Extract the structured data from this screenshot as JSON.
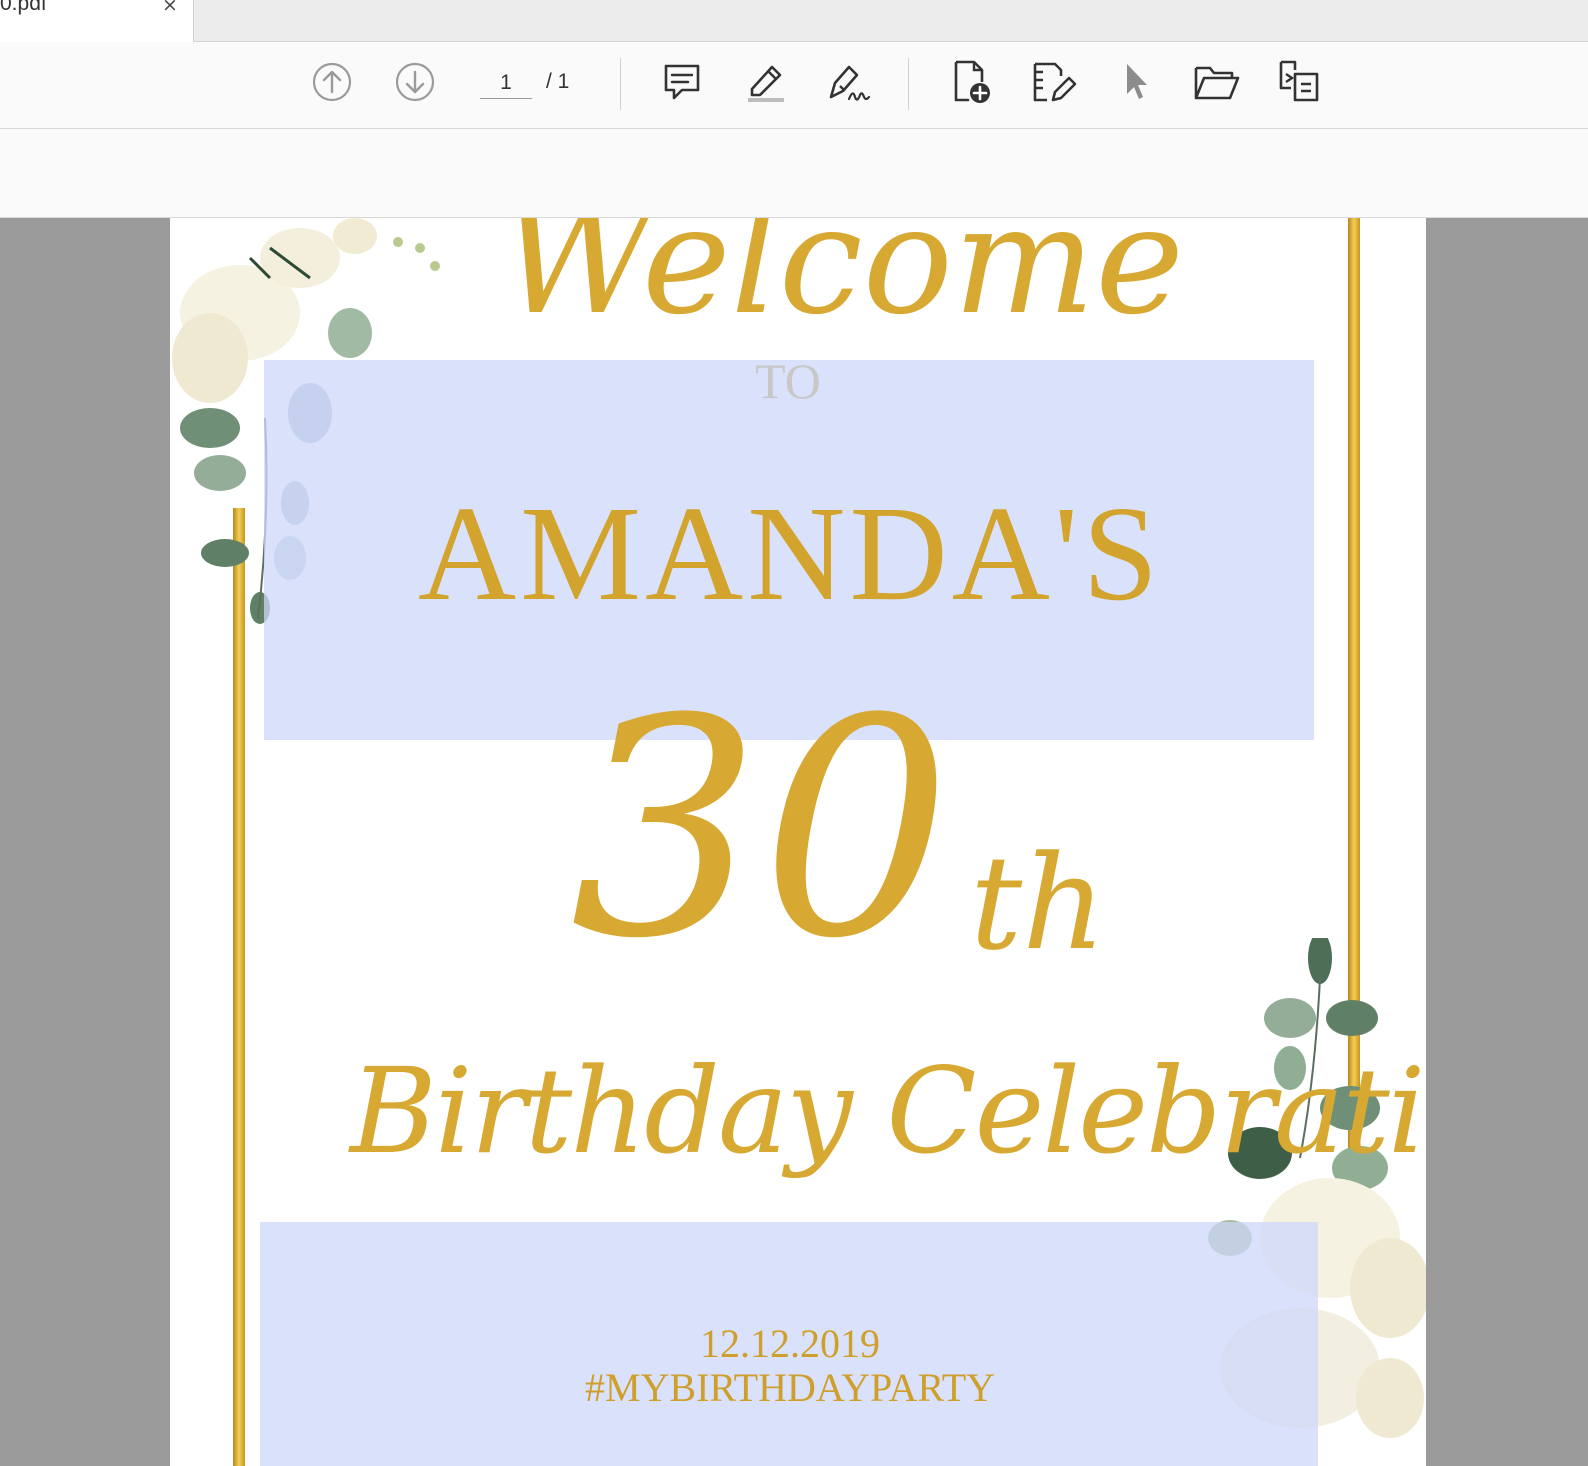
{
  "tab": {
    "title": "0.pdf",
    "close": "×"
  },
  "toolbar": {
    "icons": [
      "arrow-up-circle-icon",
      "arrow-down-circle-icon",
      "comment-icon",
      "highlighter-icon",
      "signature-pen-icon",
      "add-page-icon",
      "edit-page-icon",
      "pointer-icon",
      "open-folder-icon",
      "copy-pages-icon"
    ],
    "page_current": "1",
    "page_total": "/ 1"
  },
  "document": {
    "welcome": "Welcome",
    "to": "TO",
    "name": "AMANDA'S",
    "number": "30",
    "ordinal": "th",
    "subtitle": "Birthday Celebration",
    "date": "12.12.2019",
    "hashtag": "#MYBIRTHDAYPARTY"
  },
  "colors": {
    "gold": "#d7a832",
    "field_highlight": "#d3dcfb",
    "viewport_bg": "#9b9b9b"
  }
}
